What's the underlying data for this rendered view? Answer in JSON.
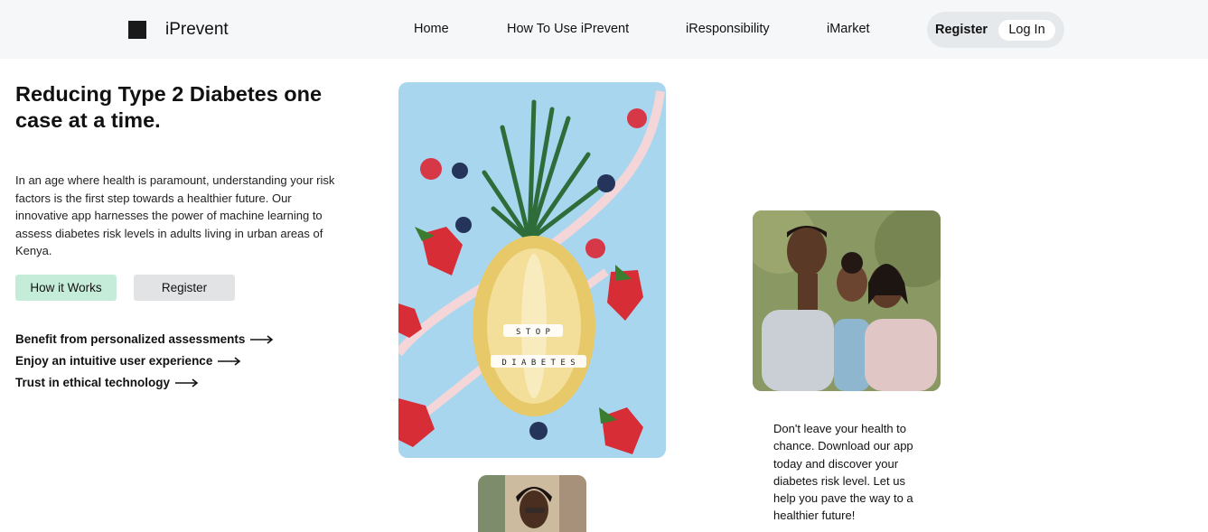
{
  "nav": {
    "brand": "iPrevent",
    "links": [
      "Home",
      "How To Use iPrevent",
      "iResponsibility",
      "iMarket"
    ],
    "register_label": "Register",
    "login_label": "Log In"
  },
  "hero": {
    "title": "Reducing Type 2 Diabetes one case at a time.",
    "description": "In an age where health is paramount, understanding your risk factors is the first step towards a healthier future. Our innovative app harnesses the power of machine learning to assess diabetes risk levels in adults living in urban areas of Kenya.",
    "primary_button": "How it Works",
    "secondary_button": "Register",
    "benefits": [
      "Benefit from personalized assessments",
      "Enjoy an intuitive user experience",
      "Trust in ethical technology"
    ]
  },
  "photos": {
    "pineapple_letters_top": "S T O P",
    "pineapple_letters_bottom": "D I A B E T E S"
  },
  "cta": {
    "text": "Don't leave your health to chance. Download our app today and discover your diabetes risk level. Let us help you pave the way to a healthier future!"
  },
  "colors": {
    "nav_bg": "#f5f7f9",
    "primary_button_bg": "#c5ecd9",
    "secondary_button_bg": "#e1e3e5",
    "pill_bg": "#e6e9ec"
  }
}
